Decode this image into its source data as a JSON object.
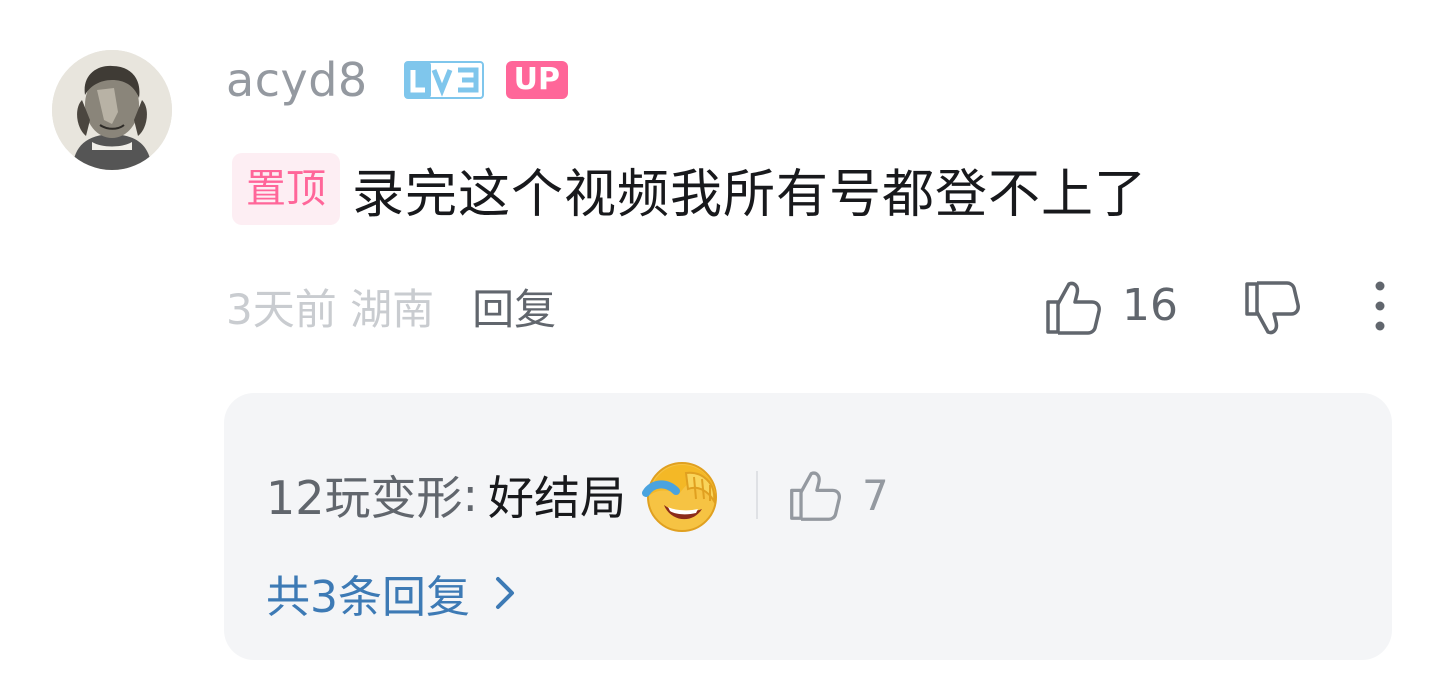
{
  "comment": {
    "username": "acyd8",
    "level_badge": "LV3",
    "up_badge": "UP",
    "pin_tag": "置顶",
    "content": "录完这个视频我所有号都登不上了",
    "time_location": "3天前 湖南",
    "reply_label": "回复",
    "like_count": "16"
  },
  "reply_preview": {
    "author": "12玩变形",
    "colon": ":",
    "text": "好结局",
    "emoji": "laughing-crying-emoji",
    "like_count": "7",
    "more_replies_label": "共3条回复"
  },
  "colors": {
    "username": "#9499a0",
    "up_badge": "#ff6699",
    "level_badge": "#7fc6ec",
    "pin_tag_text": "#ff6699",
    "pin_tag_bg": "#fdeef3",
    "more_replies": "#3d7ab5",
    "reply_box_bg": "#f4f5f7"
  }
}
